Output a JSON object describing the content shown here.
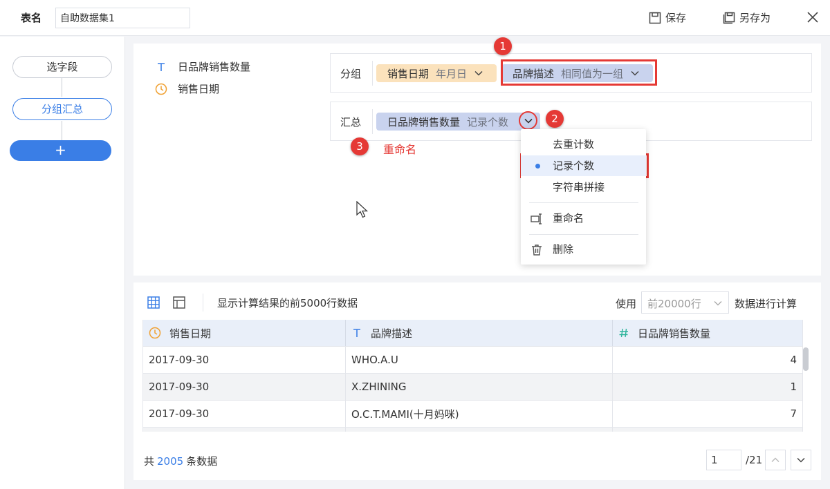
{
  "topbar": {
    "table_name_label": "表名",
    "table_name_value": "自助数据集1",
    "save_label": "保存",
    "save_as_label": "另存为"
  },
  "steps": {
    "items": [
      {
        "label": "选字段"
      },
      {
        "label": "分组汇总"
      }
    ],
    "add_label": "+"
  },
  "fields": [
    {
      "type_icon": "text-type-icon",
      "label": "日品牌销售数量"
    },
    {
      "type_icon": "clock-date-icon",
      "label": "销售日期"
    }
  ],
  "group": {
    "label": "分组",
    "chips": [
      {
        "name": "销售日期",
        "mode": "年月日"
      },
      {
        "name": "品牌描述",
        "mode": "相同值为一组"
      }
    ]
  },
  "summary": {
    "label": "汇总",
    "chip": {
      "name": "日品牌销售数量",
      "mode": "记录个数"
    }
  },
  "annotations": {
    "badge_1": "1",
    "badge_2": "2",
    "badge_3": "3",
    "rename_note": "重命名"
  },
  "menu": {
    "items": [
      {
        "label": "去重计数"
      },
      {
        "label": "记录个数",
        "selected": true
      },
      {
        "label": "字符串拼接"
      }
    ],
    "rename_label": "重命名",
    "delete_label": "删除"
  },
  "preview": {
    "info": "显示计算结果的前5000行数据",
    "use_label": "使用",
    "row_limit_placeholder": "前20000行",
    "calc_label": "数据进行计算",
    "columns": [
      {
        "icon": "clock-date-icon",
        "label": "销售日期"
      },
      {
        "icon": "text-type-icon",
        "label": "品牌描述"
      },
      {
        "icon": "number-type-icon",
        "label": "日品牌销售数量"
      }
    ],
    "rows": [
      [
        "2017-09-30",
        "WHO.A.U",
        "4"
      ],
      [
        "2017-09-30",
        "X.ZHINING",
        "1"
      ],
      [
        "2017-09-30",
        "O.C.T.MAMI(十月妈咪)",
        "7"
      ]
    ],
    "total_prefix": "共",
    "total_count": "2005",
    "total_suffix": "条数据",
    "page_value": "1",
    "page_total": "/21"
  },
  "colors": {
    "accent": "#3a7ee6",
    "annotation_red": "#e53935",
    "chip_orange": "#fbe2bc",
    "chip_blue": "#c9d3ee"
  }
}
